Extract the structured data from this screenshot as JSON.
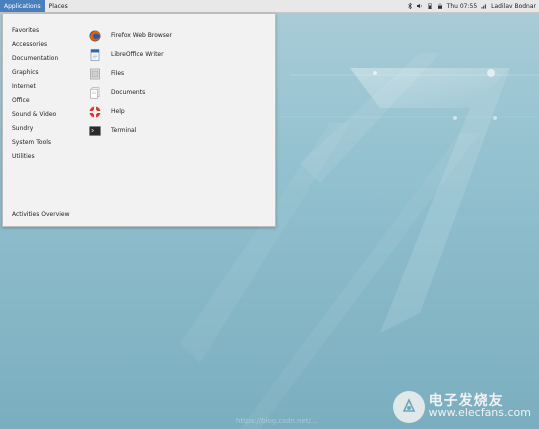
{
  "panel": {
    "applications_label": "Applications",
    "places_label": "Places",
    "clock": "Thu 07:55",
    "user_name": "Ladilav Bodnar",
    "icons": [
      "bluetooth-icon",
      "volume-icon",
      "battery-icon",
      "lock-icon",
      "network-icon"
    ]
  },
  "menu": {
    "categories": [
      {
        "label": "Favorites"
      },
      {
        "label": "Accessories"
      },
      {
        "label": "Documentation"
      },
      {
        "label": "Graphics"
      },
      {
        "label": "Internet"
      },
      {
        "label": "Office"
      },
      {
        "label": "Sound & Video"
      },
      {
        "label": "Sundry"
      },
      {
        "label": "System Tools"
      },
      {
        "label": "Utilities"
      }
    ],
    "activities_label": "Activities Overview",
    "apps": [
      {
        "label": "Firefox Web Browser",
        "icon": "firefox-icon"
      },
      {
        "label": "LibreOffice Writer",
        "icon": "writer-icon"
      },
      {
        "label": "Files",
        "icon": "files-icon"
      },
      {
        "label": "Documents",
        "icon": "documents-icon"
      },
      {
        "label": "Help",
        "icon": "help-icon"
      },
      {
        "label": "Terminal",
        "icon": "terminal-icon"
      }
    ]
  },
  "watermark": {
    "cn": "电子发烧友",
    "site": "www.elecfans.com",
    "url": "https://blog.csdn.net/..."
  },
  "colors": {
    "accent": "#4a7fbd",
    "menu_bg": "#f2f2f2",
    "wallpaper": "#90bfce"
  }
}
